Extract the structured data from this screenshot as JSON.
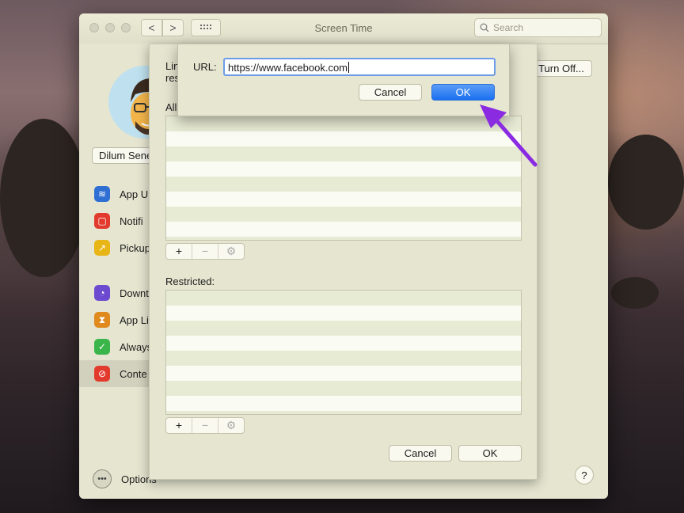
{
  "window": {
    "title": "Screen Time",
    "search_placeholder": "Search",
    "nav_back": "<",
    "nav_forward": ">",
    "grid_icon": "grid-icon"
  },
  "sidebar": {
    "user_name": "Dilum Sene",
    "items": [
      {
        "label": "App U",
        "icon": "layers-icon",
        "color": "#2f6fd3"
      },
      {
        "label": "Notifi",
        "icon": "notification-icon",
        "color": "#e23b2e"
      },
      {
        "label": "Pickup",
        "icon": "phone-pickup-icon",
        "color": "#e8b517"
      },
      {
        "label": "Downt",
        "icon": "downtime-icon",
        "color": "#6c4bd1"
      },
      {
        "label": "App Li",
        "icon": "hourglass-icon",
        "color": "#e08a1e"
      },
      {
        "label": "Always",
        "icon": "checkmark-badge-icon",
        "color": "#3ab54a"
      },
      {
        "label": "Conte",
        "icon": "restricted-icon",
        "color": "#e23b2e"
      }
    ],
    "options_label": "Options"
  },
  "main": {
    "turn_off_label": "Turn Off..."
  },
  "sheet": {
    "limit_text_line1": "Lin",
    "limit_text_line2": "res",
    "allowed_label": "All",
    "restricted_label": "Restricted:",
    "add_symbol": "+",
    "remove_symbol": "−",
    "gear_symbol": "⚙",
    "cancel_label": "Cancel",
    "ok_label": "OK"
  },
  "dialog": {
    "url_label": "URL:",
    "url_value": "https://www.facebook.com",
    "cancel_label": "Cancel",
    "ok_label": "OK"
  },
  "help_symbol": "?",
  "colors": {
    "accent_blue": "#1a6ff0",
    "annotation_arrow": "#8a2be2"
  }
}
